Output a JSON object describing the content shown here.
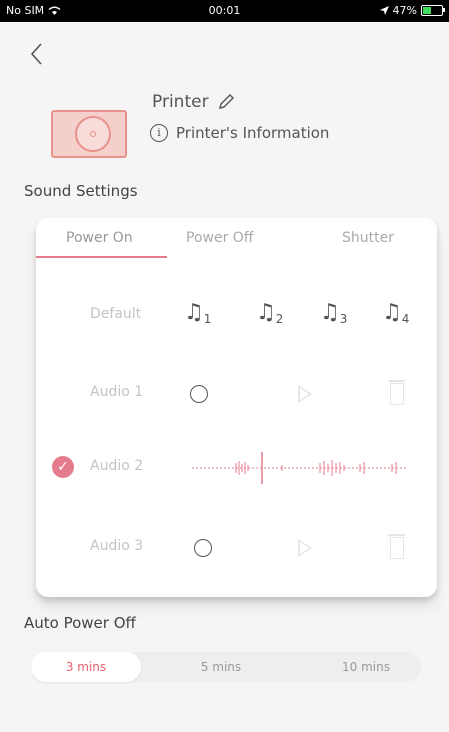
{
  "status": {
    "carrier": "No SIM",
    "time": "00:01",
    "battery": "47%"
  },
  "printer": {
    "name": "Printer",
    "info_label": "Printer's Information"
  },
  "sound_settings": {
    "title": "Sound Settings",
    "tabs": [
      "Power On",
      "Power Off",
      "Shutter"
    ],
    "selected_tab": "Power On",
    "default_label": "Default",
    "notes": [
      {
        "icon": "music-note-icon",
        "number": "1"
      },
      {
        "icon": "music-note-icon",
        "number": "2"
      },
      {
        "icon": "music-note-icon",
        "number": "3"
      },
      {
        "icon": "music-note-icon",
        "number": "4"
      }
    ],
    "audio_rows": [
      {
        "label": "Audio 1",
        "selected": false,
        "has_recording": false
      },
      {
        "label": "Audio 2",
        "selected": true,
        "has_recording": true
      },
      {
        "label": "Audio 3",
        "selected": false,
        "has_recording": false
      }
    ]
  },
  "auto_power_off": {
    "title": "Auto Power Off",
    "options": [
      "3 mins",
      "5 mins",
      "10 mins"
    ],
    "selected": "3 mins"
  },
  "colors": {
    "accent": "#e57c8d",
    "printer_pink": "#e9928c",
    "bg": "#f6f5f5"
  }
}
